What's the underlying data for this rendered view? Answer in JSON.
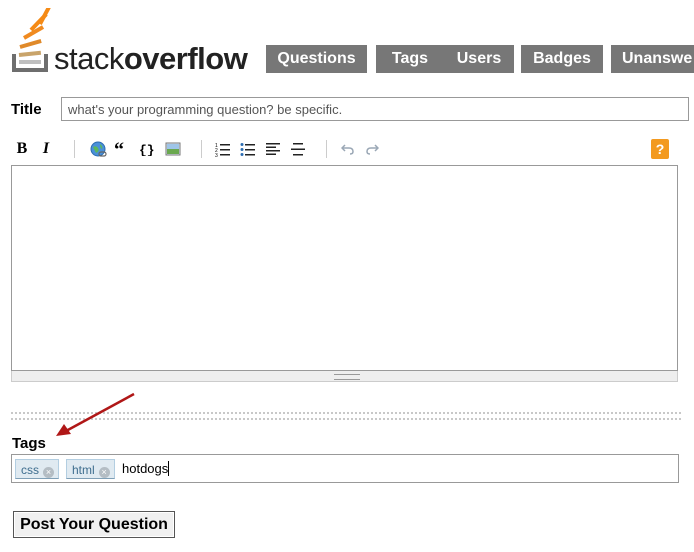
{
  "header": {
    "logo_text_light": "stack",
    "logo_text_bold": "overflow",
    "logo_icon": "stack-logo-icon",
    "nav": [
      {
        "label": "Questions"
      },
      {
        "label": "Tags"
      },
      {
        "label": "Users"
      },
      {
        "label": "Badges"
      },
      {
        "label": "Unanswe"
      }
    ]
  },
  "form": {
    "title_label": "Title",
    "title_placeholder": "what's your programming question? be specific.",
    "toolbar": {
      "bold": "B",
      "italic": "I",
      "help": "?"
    },
    "tags_label": "Tags",
    "tags": [
      {
        "label": "css"
      },
      {
        "label": "html"
      }
    ],
    "tag_input_value": "hotdogs",
    "submit_label": "Post Your Question"
  },
  "colors": {
    "nav_bg": "#777777",
    "tag_bg": "#e0eaf1",
    "tag_text": "#3e6d8e",
    "help_bg": "#f39a1f",
    "annotation_arrow": "#b01717"
  }
}
